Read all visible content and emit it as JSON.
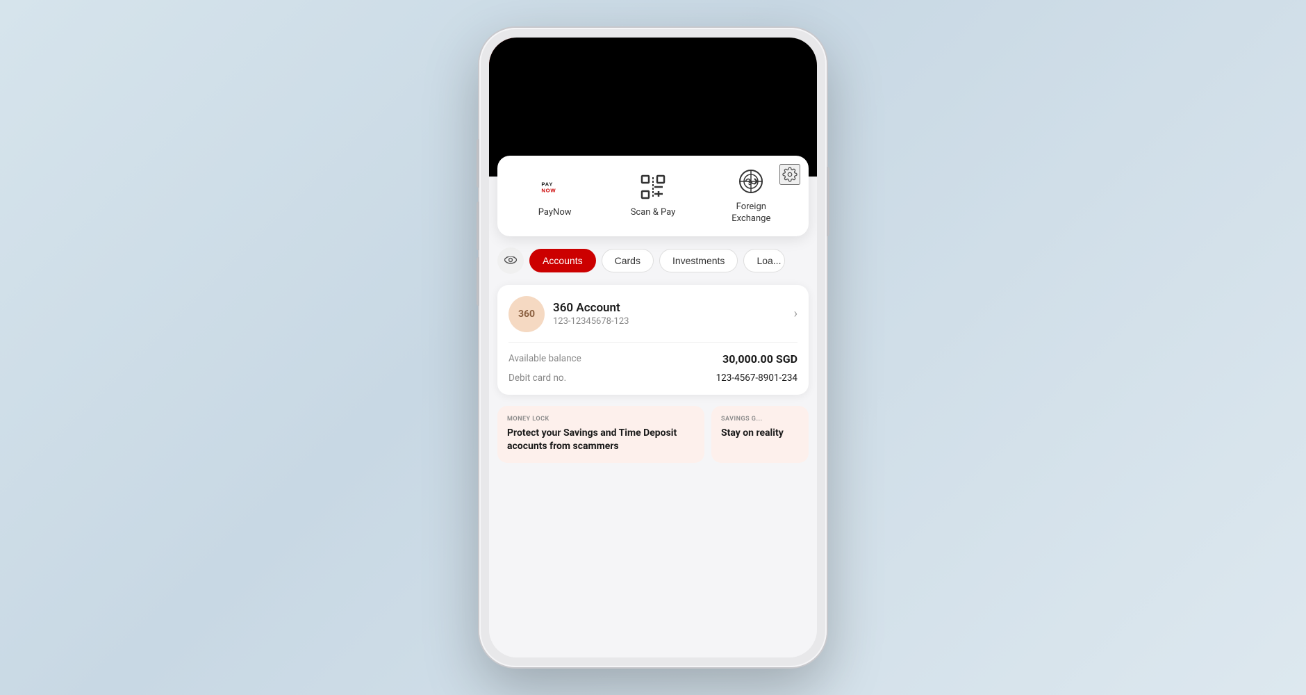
{
  "background": "#cdd8e0",
  "phone": {
    "quick_actions": {
      "settings_icon_label": "settings",
      "items": [
        {
          "id": "paynow",
          "label": "PayNow",
          "icon": "paynow"
        },
        {
          "id": "scan-pay",
          "label": "Scan & Pay",
          "icon": "scan"
        },
        {
          "id": "foreign-exchange",
          "label": "Foreign Exchange",
          "icon": "forex"
        }
      ]
    },
    "tabs": {
      "eye_label": "visibility toggle",
      "items": [
        {
          "id": "accounts",
          "label": "Accounts",
          "active": true
        },
        {
          "id": "cards",
          "label": "Cards",
          "active": false
        },
        {
          "id": "investments",
          "label": "Investments",
          "active": false
        },
        {
          "id": "loans",
          "label": "Loa...",
          "active": false
        }
      ]
    },
    "account": {
      "badge": "360",
      "name": "360 Account",
      "number": "123-12345678-123",
      "balance_label": "Available balance",
      "balance_value": "30,000.00 SGD",
      "card_label": "Debit card no.",
      "card_value": "123-4567-8901-234"
    },
    "promo_cards": [
      {
        "tag": "MONEY LOCK",
        "title": "Protect your Savings and Time Deposit acocunts from scammers"
      },
      {
        "tag": "SAVINGS G...",
        "title": "Stay on reality"
      }
    ]
  }
}
